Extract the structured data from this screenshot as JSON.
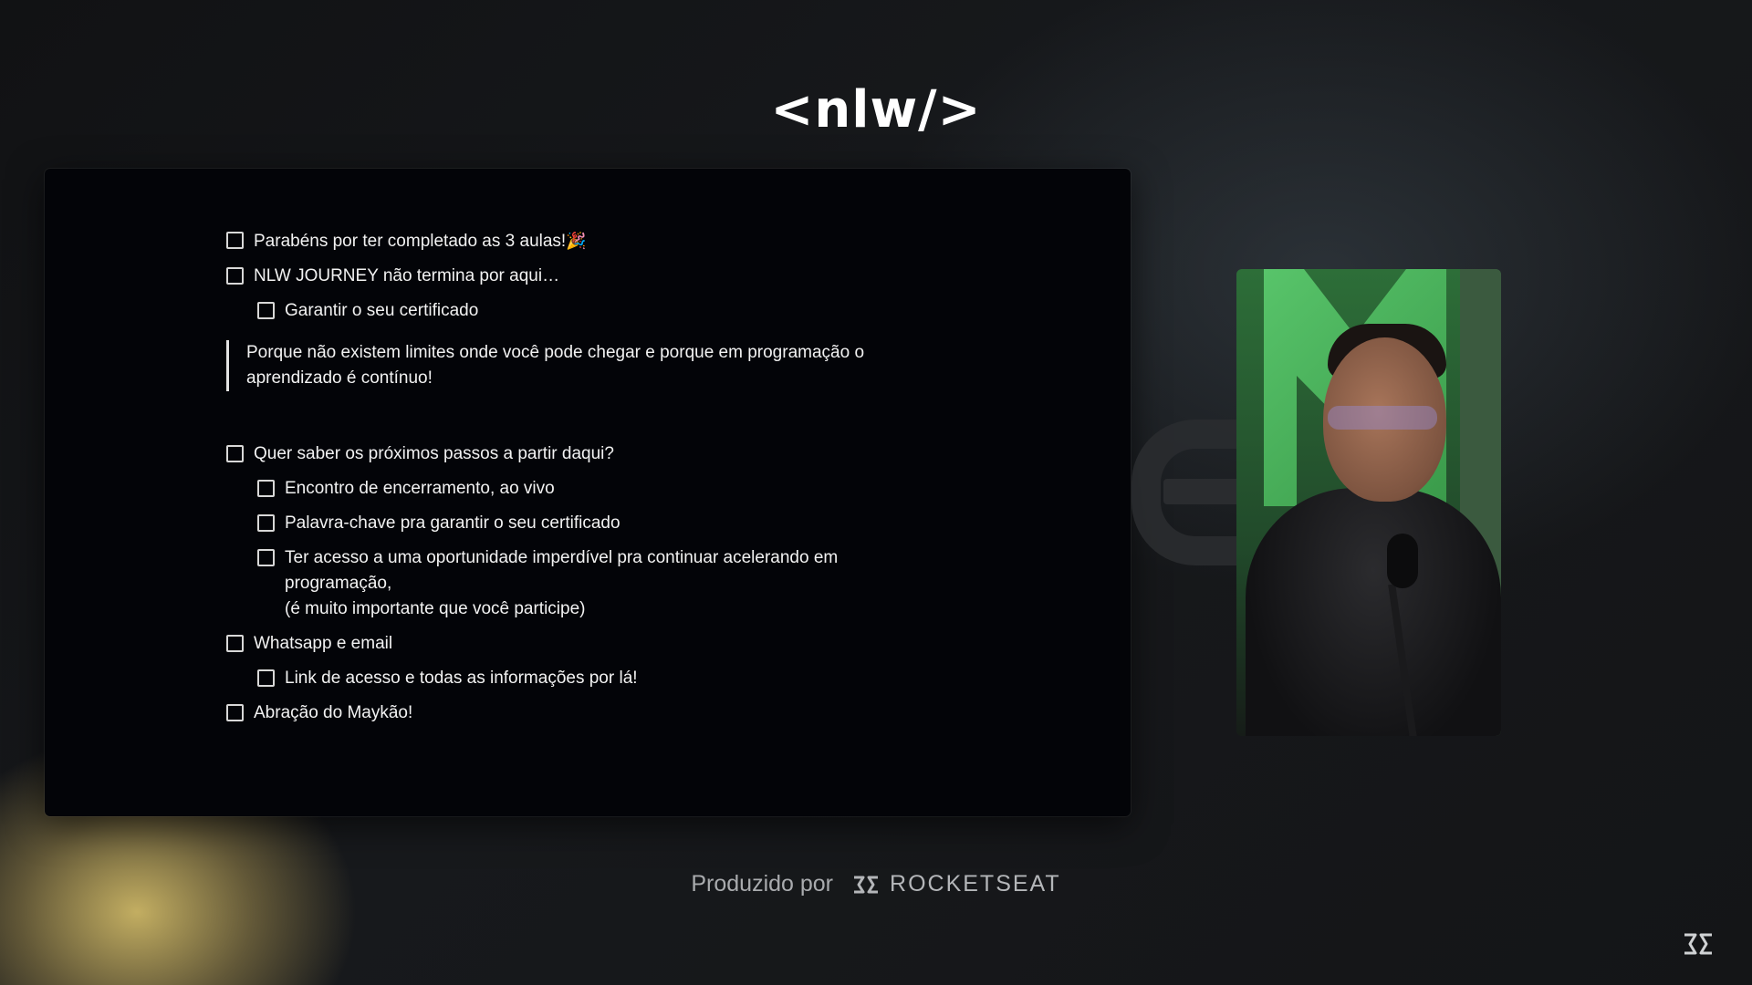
{
  "header": {
    "logo_text": "<nlw/>"
  },
  "checklist": {
    "items_top": [
      {
        "text": "Parabéns por ter completado as 3 aulas!",
        "emoji": "🎉",
        "level": 0
      },
      {
        "text": "NLW JOURNEY não termina por aqui…",
        "level": 0
      },
      {
        "text": "Garantir o seu certificado",
        "level": 1
      }
    ],
    "quote": "Porque não existem limites onde você pode chegar e porque em programação o aprendizado é contínuo!",
    "items_bottom": [
      {
        "text": "Quer saber os próximos passos a partir daqui?",
        "level": 0
      },
      {
        "text": "Encontro de encerramento, ao vivo",
        "level": 1
      },
      {
        "text": "Palavra-chave pra garantir o seu certificado",
        "level": 1
      },
      {
        "text": "Ter acesso a uma oportunidade imperdível pra continuar acelerando em programação,",
        "sub": "(é muito importante que você participe)",
        "level": 1
      },
      {
        "text": "Whatsapp e email",
        "level": 0
      },
      {
        "text": "Link de acesso e todas as informações por lá!",
        "level": 1
      },
      {
        "text": "Abração do Maykão!",
        "level": 0
      }
    ]
  },
  "footer": {
    "produced_by": "Produzido por",
    "brand": "ROCKETSEAT"
  },
  "icons": {
    "brand_icon": "rocketseat-icon",
    "corner_icon": "rocketseat-icon"
  },
  "colors": {
    "accent_yellow": "#e1c86e",
    "slide_bg": "#030408",
    "webcam_green": "#3a9a4a"
  }
}
